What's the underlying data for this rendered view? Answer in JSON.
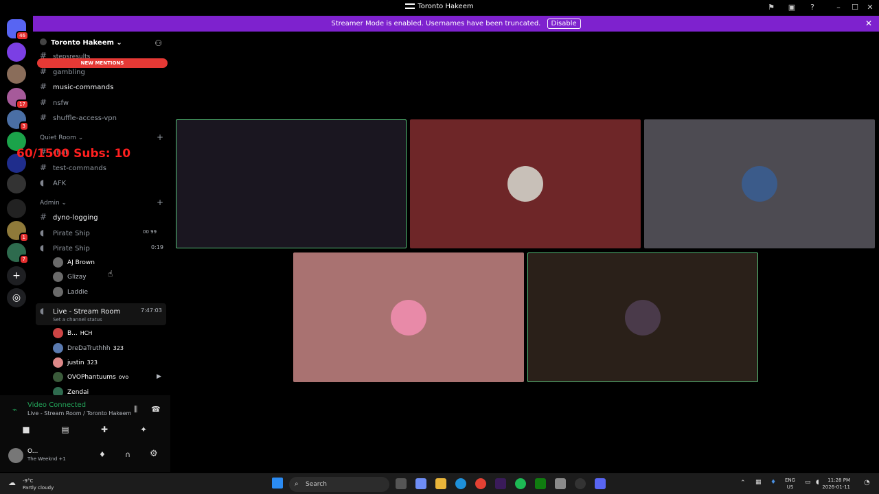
{
  "window": {
    "title": "Toronto Hakeem"
  },
  "banner": {
    "text": "Streamer Mode is enabled. Usernames have been truncated.",
    "button": "Disable"
  },
  "servers": [
    {
      "badge": "46",
      "color": "#5865f2"
    },
    {
      "badge": "",
      "color": "#7b3fe4"
    },
    {
      "badge": "",
      "color": "#8a6d5a"
    },
    {
      "badge": "17",
      "color": "#a65a9a"
    },
    {
      "badge": "3",
      "color": "#4a6fa5"
    },
    {
      "badge": "",
      "color": "#1ba34a"
    },
    {
      "badge": "",
      "color": "#1f2d8c"
    },
    {
      "badge": "",
      "color": "#333333"
    },
    {
      "badge": "",
      "color": "#222222"
    },
    {
      "badge": "1",
      "color": "#8f7a3a"
    },
    {
      "badge": "7",
      "color": "#2e6b4e"
    }
  ],
  "sidebar": {
    "guild_name": "Toronto Hakeem",
    "new_mentions": "NEW MENTIONS",
    "channels_top": [
      {
        "name": "stepsresults",
        "bold": false
      },
      {
        "name": "gambling",
        "bold": false
      },
      {
        "name": "music-commands",
        "bold": true
      },
      {
        "name": "nsfw",
        "bold": false
      },
      {
        "name": "shuffle-access-vpn",
        "bold": false
      }
    ],
    "cat_quiet": "Quiet Room",
    "quiet_channels": [
      {
        "name": "chat"
      },
      {
        "name": "test-commands"
      },
      {
        "name": "AFK"
      }
    ],
    "cat_admin": "Admin",
    "admin_channels": [
      {
        "name": "dyno-logging"
      },
      {
        "name": "Pirate Ship",
        "meta": "00  99"
      },
      {
        "name": "Pirate Ship",
        "meta": "0:19"
      }
    ],
    "pirate_users": [
      "AJ Brown",
      "Glizay",
      "Laddie"
    ],
    "stream_room": {
      "name": "Live - Stream Room",
      "time": "7:47:03",
      "status": "Set a channel status"
    },
    "stream_users": [
      {
        "name": "B...",
        "tag": "HCH"
      },
      {
        "name": "DreDaTruthhh",
        "tag": "323"
      },
      {
        "name": "justin",
        "tag": "323"
      },
      {
        "name": "OVOPhantuums",
        "tag": "ovo"
      },
      {
        "name": "Zendai",
        "tag": ""
      }
    ]
  },
  "overlay": {
    "subs": "60/1500  Subs: 10"
  },
  "voice": {
    "status": "Video Connected",
    "location": "Live - Stream Room / Toronto Hakeem"
  },
  "me": {
    "name": "O...",
    "activity": "The Weeknd +1"
  },
  "tiles": [
    {
      "bg": "#1a1620",
      "border": "#57c27a",
      "avatar": "#3a3040"
    },
    {
      "bg": "#6e2628",
      "border": "",
      "avatar": "#c8c0b8"
    },
    {
      "bg": "#4d4b52",
      "border": "",
      "avatar": "#3b5b8a"
    },
    {
      "bg": "#a97271",
      "border": "",
      "avatar": "#e88aa8"
    },
    {
      "bg": "#2a2019",
      "border": "#57c27a",
      "avatar": "#4a3a4a"
    }
  ],
  "taskbar": {
    "temp": "-9°C",
    "weather": "Partly cloudy",
    "search": "Search",
    "lang1": "ENG",
    "lang2": "US",
    "time": "11:28 PM",
    "date": "2026-01-11"
  }
}
